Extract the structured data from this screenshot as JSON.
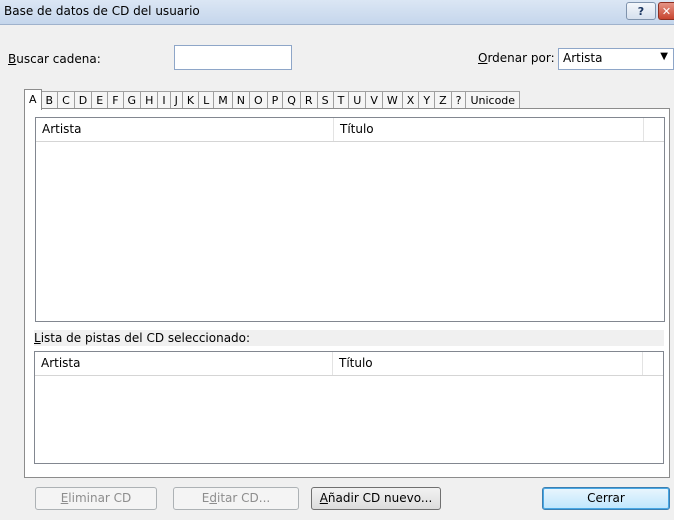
{
  "window": {
    "title": "Base de datos de CD del usuario",
    "help_button": "?",
    "close_button": "✕"
  },
  "search": {
    "label_prefix": "",
    "label_accel": "B",
    "label_rest": "uscar cadena:",
    "value": ""
  },
  "sort": {
    "label_accel": "O",
    "label_rest": "rdenar por:",
    "selected": "Artista"
  },
  "tabs": [
    "A",
    "B",
    "C",
    "D",
    "E",
    "F",
    "G",
    "H",
    "I",
    "J",
    "K",
    "L",
    "M",
    "N",
    "O",
    "P",
    "Q",
    "R",
    "S",
    "T",
    "U",
    "V",
    "W",
    "X",
    "Y",
    "Z",
    "?",
    "Unicode"
  ],
  "cd_list": {
    "columns": [
      "Artista",
      "Título"
    ],
    "rows": []
  },
  "tracks": {
    "label_accel": "L",
    "label_rest": "ista de pistas del CD seleccionado:",
    "columns": [
      "Artista",
      "Título"
    ],
    "rows": []
  },
  "buttons": {
    "delete": {
      "accel": "E",
      "rest": "liminar CD",
      "enabled": false
    },
    "edit": {
      "prefix": "E",
      "accel": "d",
      "rest": "itar CD...",
      "enabled": false
    },
    "add": {
      "accel": "A",
      "rest": "ñadir CD nuevo...",
      "enabled": true
    },
    "close": {
      "label": "Cerrar",
      "enabled": true
    }
  }
}
